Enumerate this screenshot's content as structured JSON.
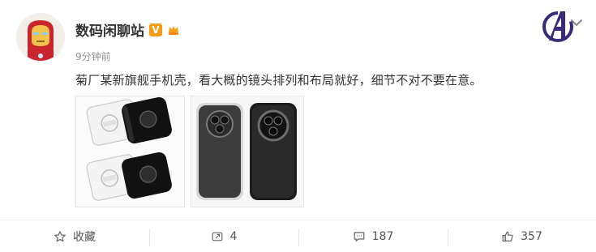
{
  "user": {
    "name": "数码闲聊站",
    "time": "9分钟前",
    "verified_badge": "V"
  },
  "post": {
    "text": "菊厂某新旗舰手机壳，看大概的镜头排列和布局就好，细节不对不要在意。"
  },
  "actions": {
    "favorite_label": "收藏",
    "repost_count": "4",
    "comment_count": "187",
    "like_count": "357"
  },
  "colors": {
    "accent": "#f59b16",
    "text": "#333333",
    "muted": "#939393"
  },
  "icons": [
    "avatar-ironman",
    "avengers-logo-icon",
    "chevron-down-icon",
    "star-icon",
    "repost-icon",
    "comment-icon",
    "like-icon"
  ]
}
